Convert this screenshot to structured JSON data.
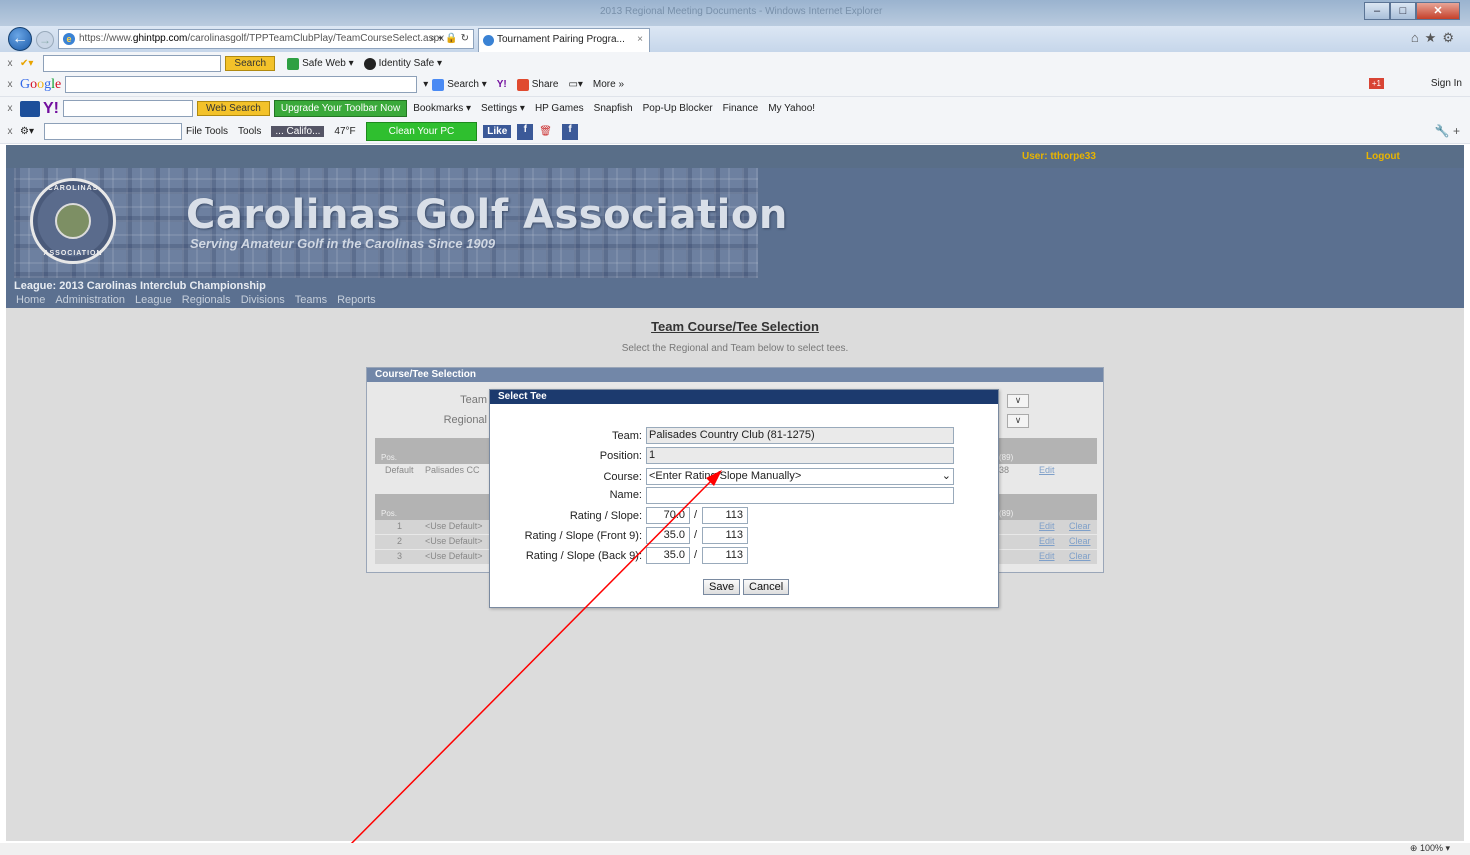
{
  "browser": {
    "window_title": "2013 Regional Meeting Documents - Windows Internet Explorer",
    "address_prefix": "https://www.",
    "address_host": "ghintpp.com",
    "address_path": "/carolinasgolf/TPPTeamClubPlay/TeamCourseSelect.aspx",
    "tab_title": "Tournament Pairing Progra...",
    "toolbar1": {
      "search_btn": "Search",
      "safe_web": "Safe Web ▾",
      "identity_safe": "Identity Safe ▾"
    },
    "toolbar2": {
      "search": "Search ▾",
      "share": "Share",
      "more": "More »",
      "sign_in": "Sign In"
    },
    "toolbar3": {
      "web_search": "Web Search",
      "upgrade": "Upgrade Your Toolbar Now",
      "bookmarks": "Bookmarks ▾",
      "settings": "Settings ▾",
      "hp_games": "HP Games",
      "snapfish": "Snapfish",
      "popup": "Pop-Up Blocker",
      "finance": "Finance",
      "myyahoo": "My Yahoo!"
    },
    "toolbar4": {
      "file_tools": "File Tools",
      "tools": "Tools",
      "weather_loc": "... Califo...",
      "temp": "47°F",
      "clean_pc": "Clean Your PC",
      "fb_like": "Like"
    },
    "zoom": "100%"
  },
  "site": {
    "user": "User: tthorpe33",
    "logout": "Logout",
    "org_name": "Carolinas Golf Association",
    "tagline": "Serving Amateur Golf in the Carolinas Since 1909",
    "seal_top": "CAROLINAS",
    "seal_bottom": "ASSOCIATION",
    "league": "League: 2013 Carolinas Interclub Championship",
    "menu": [
      "Home",
      "Administration",
      "League",
      "Regionals",
      "Divisions",
      "Teams",
      "Reports"
    ]
  },
  "main": {
    "title": "Team Course/Tee Selection",
    "subtitle": "Select the Regional and Team below to select tees.",
    "panel_title": "Course/Tee Selection",
    "team_label": "Team",
    "regional_label": "Regional",
    "pos_header": "Pos.",
    "default_row": {
      "pos": "Default",
      "club": "Palisades CC",
      "tail": "38",
      "edit": "Edit"
    },
    "right_header": "(89)",
    "rows": [
      {
        "pos": "1",
        "value": "<Use Default>",
        "edit": "Edit",
        "clear": "Clear"
      },
      {
        "pos": "2",
        "value": "<Use Default>",
        "edit": "Edit",
        "clear": "Clear"
      },
      {
        "pos": "3",
        "value": "<Use Default>",
        "edit": "Edit",
        "clear": "Clear"
      }
    ]
  },
  "modal": {
    "title": "Select Tee",
    "team_label": "Team:",
    "team_value": "Palisades Country Club (81-1275)",
    "position_label": "Position:",
    "position_value": "1",
    "course_label": "Course:",
    "course_value": "<Enter Rating/Slope Manually>",
    "name_label": "Name:",
    "name_value": "",
    "rating_label": "Rating / Slope:",
    "rating_value": "70.0",
    "slope_value": "113",
    "front_label": "Rating / Slope (Front 9):",
    "front_rating": "35.0",
    "front_slope": "113",
    "back_label": "Rating / Slope (Back 9):",
    "back_rating": "35.0",
    "back_slope": "113",
    "slash": "/",
    "save": "Save",
    "cancel": "Cancel"
  },
  "colors": {
    "annotation_arrow": "#ff0000",
    "banner": "#5b7090",
    "modal_header": "#1c3a6e",
    "user_text": "#e8b400"
  }
}
